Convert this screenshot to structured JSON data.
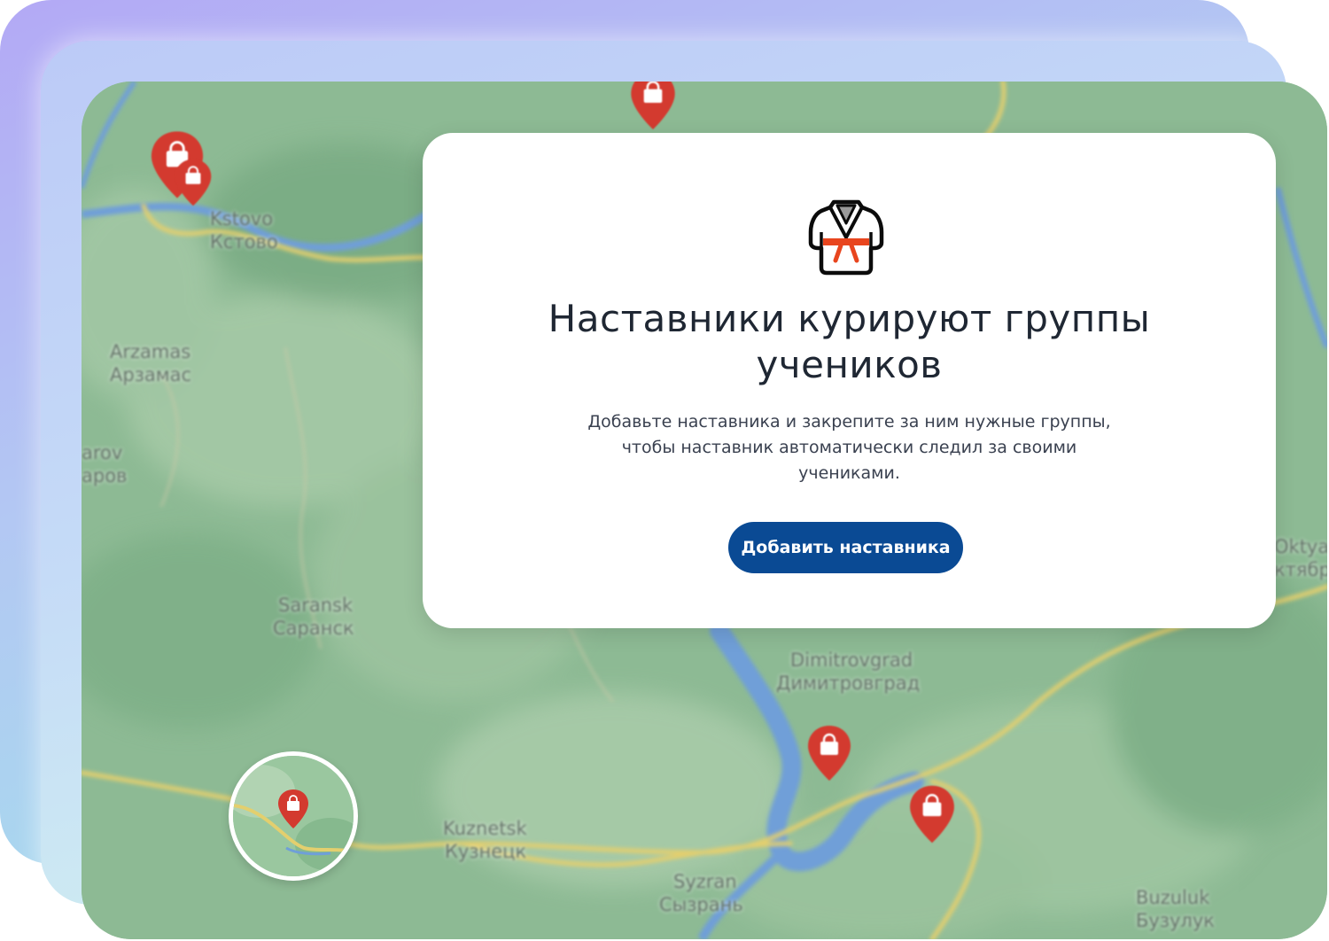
{
  "map": {
    "labels": {
      "kstovo_latin": "Kstovo",
      "kstovo_cyrillic": "Кстово",
      "arzamas_latin": "Arzamas",
      "arzamas_cyrillic": "Арзамас",
      "sarov_latin": "arov",
      "sarov_cyrillic": "apoв",
      "saransk_latin": "Saransk",
      "saransk_cyrillic": "Саранск",
      "dimitrovgrad_latin": "Dimitrovgrad",
      "dimitrovgrad_cyrillic": "Димитровград",
      "kuznetsk_latin": "Kuznetsk",
      "kuznetsk_cyrillic": "Кузнецк",
      "syzran_latin": "Syzran",
      "syzran_cyrillic": "Сызрань",
      "buzuluk_latin": "Buzuluk",
      "buzuluk_cyrillic": "Бузулук",
      "oktyabrsky_latin": "Oktya",
      "oktyabrsky_cyrillic": "ктябр"
    },
    "colors": {
      "land": "#8dba94",
      "water": "#6f9fd8",
      "road": "#e3cf6e",
      "pin": "#d33a2f"
    },
    "pin_icon": "shopping-bag-icon"
  },
  "modal": {
    "icon": "kimono-icon",
    "title": "Наставники курируют группы учеников",
    "description": "Добавьте наставника и закрепите за ним нужные группы, чтобы наставник автоматически следил за своими учениками.",
    "button_label": "Добавить наставника",
    "accent_color": "#0a4a94"
  }
}
